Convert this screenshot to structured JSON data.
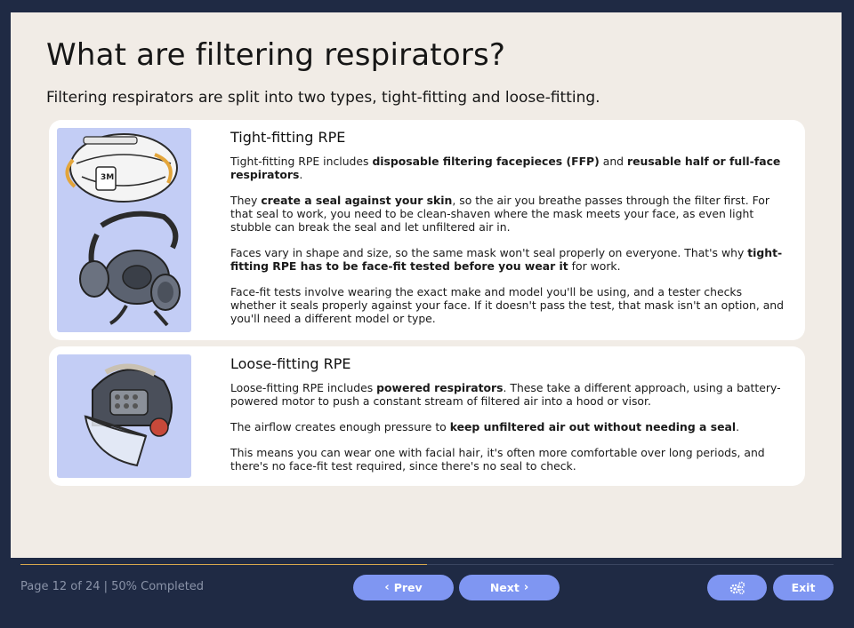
{
  "slide": {
    "title": "What are filtering respirators?",
    "subtitle": "Filtering respirators are split into two types, tight-fitting and loose-fitting."
  },
  "cards": [
    {
      "heading": "Tight-fitting RPE",
      "paragraphs": [
        [
          {
            "t": "Tight-fitting RPE includes "
          },
          {
            "t": "disposable filtering facepieces (FFP)",
            "b": true
          },
          {
            "t": " and "
          },
          {
            "t": "reusable half or full-face respirators",
            "b": true
          },
          {
            "t": "."
          }
        ],
        [
          {
            "t": "They "
          },
          {
            "t": "create a seal against your skin",
            "b": true
          },
          {
            "t": ", so the air you breathe passes through the filter first. For that seal to work, you need to be clean-shaven where the mask meets your face, as even light stubble can break the seal and let unfiltered air in."
          }
        ],
        [
          {
            "t": "Faces vary in shape and size, so the same mask won't seal properly on everyone. That's why "
          },
          {
            "t": "tight-fitting RPE has to be face-fit tested before you wear it",
            "b": true
          },
          {
            "t": " for work."
          }
        ],
        [
          {
            "t": "Face-fit tests involve wearing the exact make and model you'll be using, and a tester checks whether it seals properly against your face. If it doesn't pass the test, that mask isn't an option, and you'll need a different model or type."
          }
        ]
      ]
    },
    {
      "heading": "Loose-fitting RPE",
      "paragraphs": [
        [
          {
            "t": "Loose-fitting RPE includes "
          },
          {
            "t": "powered respirators",
            "b": true
          },
          {
            "t": ". These take a different approach, using a battery-powered motor to push a constant stream of filtered air into a hood or visor."
          }
        ],
        [
          {
            "t": "The airflow creates enough pressure to "
          },
          {
            "t": "keep unfiltered air out without needing a seal",
            "b": true
          },
          {
            "t": "."
          }
        ],
        [
          {
            "t": "This means you can wear one with facial hair, it's often more comfortable over long periods, and there's no face-fit test required, since there's no seal to check."
          }
        ]
      ]
    }
  ],
  "footer": {
    "page_status": "Page 12 of 24 | 50% Completed",
    "progress": 0.5,
    "prev_label": "Prev",
    "next_label": "Next",
    "exit_label": "Exit",
    "settings_icon": "gears-icon"
  },
  "colors": {
    "background": "#1f2a44",
    "slide": "#f1ece6",
    "button": "#7f96f2",
    "progress": "#d7a84d",
    "image_bg": "#c3cdf5"
  }
}
